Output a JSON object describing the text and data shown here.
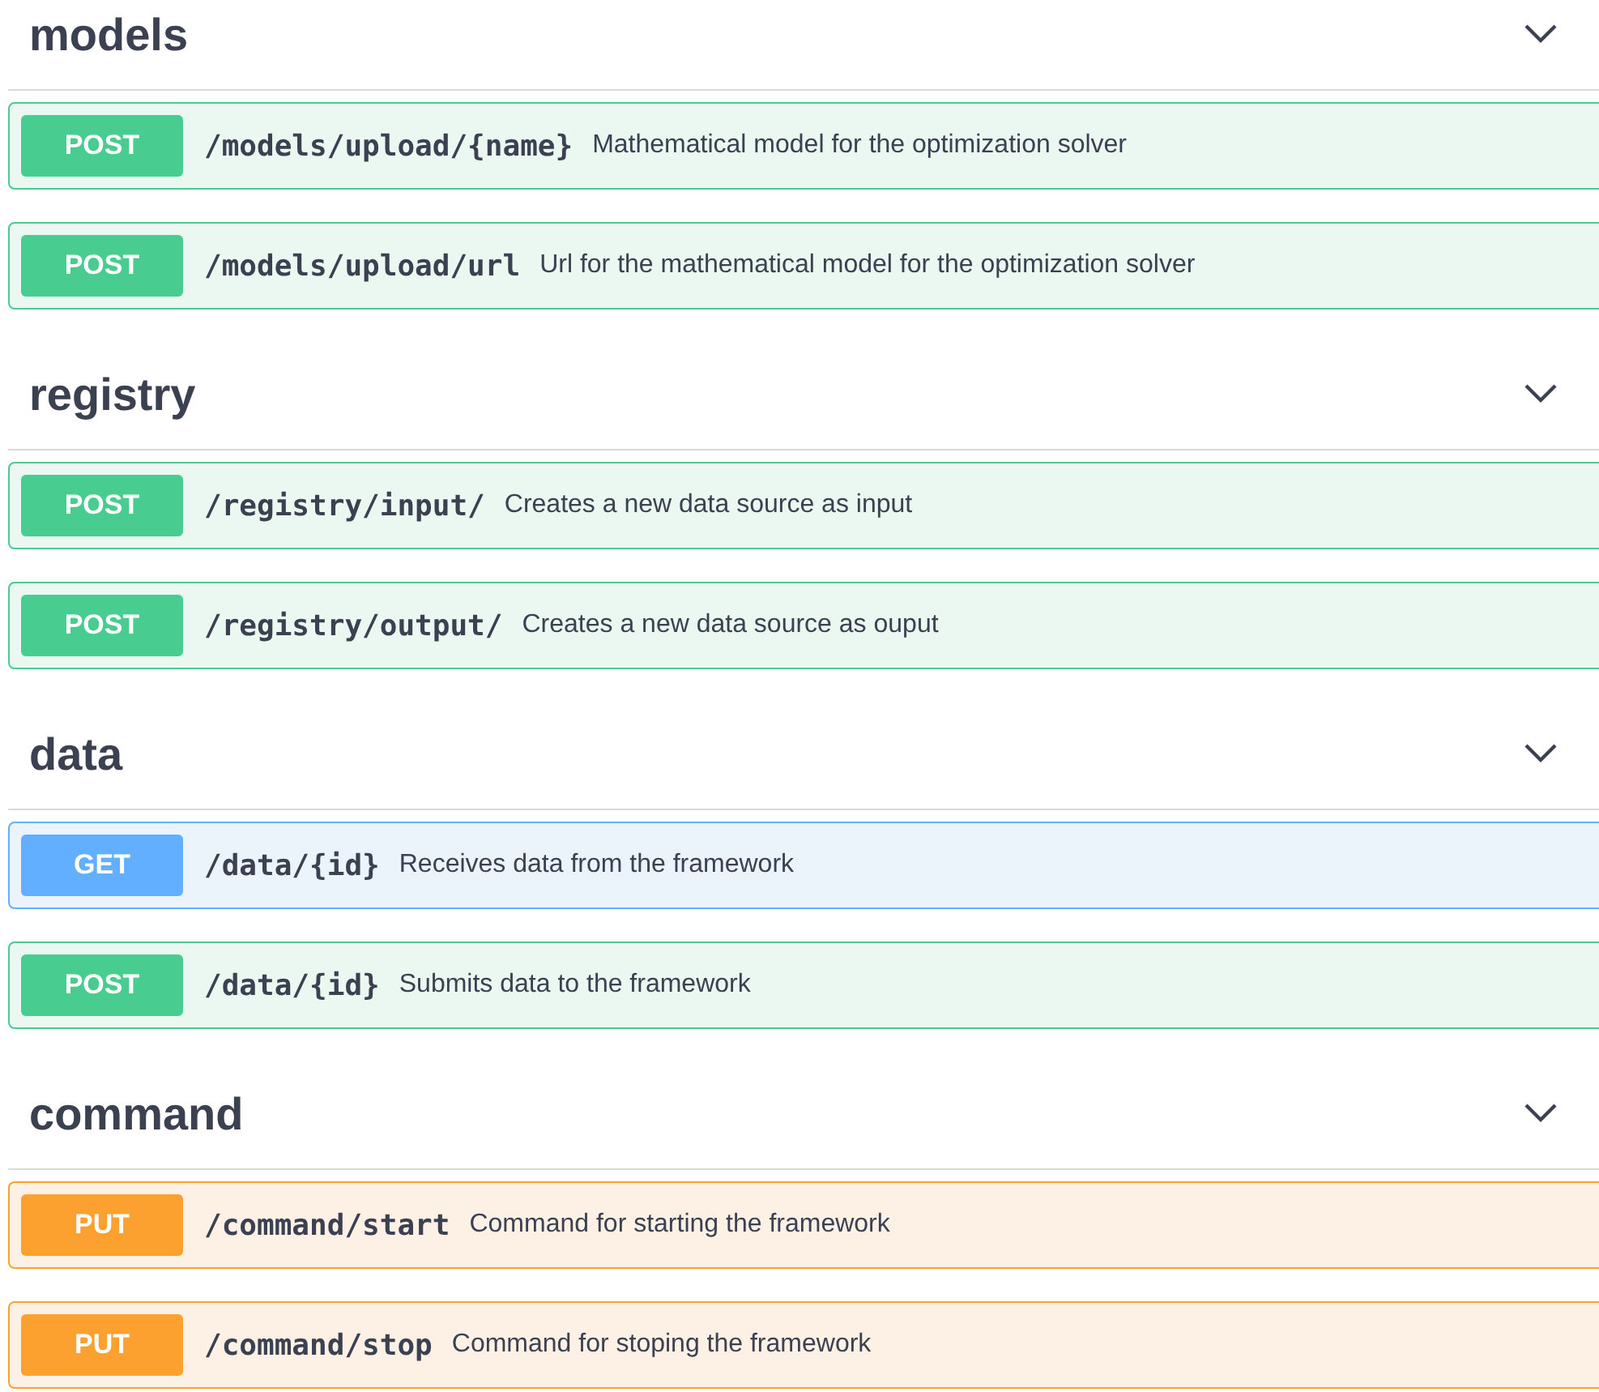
{
  "sections": [
    {
      "title": "models",
      "expanded": true,
      "operations": [
        {
          "method": "POST",
          "kind": "post",
          "path": "/models/upload/{name}",
          "summary": "Mathematical model for the optimization solver"
        },
        {
          "method": "POST",
          "kind": "post",
          "path": "/models/upload/url",
          "summary": "Url for the mathematical model for the optimization solver"
        }
      ]
    },
    {
      "title": "registry",
      "expanded": true,
      "operations": [
        {
          "method": "POST",
          "kind": "post",
          "path": "/registry/input/",
          "summary": "Creates a new data source as input"
        },
        {
          "method": "POST",
          "kind": "post",
          "path": "/registry/output/",
          "summary": "Creates a new data source as ouput"
        }
      ]
    },
    {
      "title": "data",
      "expanded": true,
      "operations": [
        {
          "method": "GET",
          "kind": "get",
          "path": "/data/{id}",
          "summary": "Receives data from the framework"
        },
        {
          "method": "POST",
          "kind": "post",
          "path": "/data/{id}",
          "summary": "Submits data to the framework"
        }
      ]
    },
    {
      "title": "command",
      "expanded": true,
      "operations": [
        {
          "method": "PUT",
          "kind": "put",
          "path": "/command/start",
          "summary": "Command for starting the framework"
        },
        {
          "method": "PUT",
          "kind": "put",
          "path": "/command/stop",
          "summary": "Command for stoping the framework"
        }
      ]
    }
  ]
}
